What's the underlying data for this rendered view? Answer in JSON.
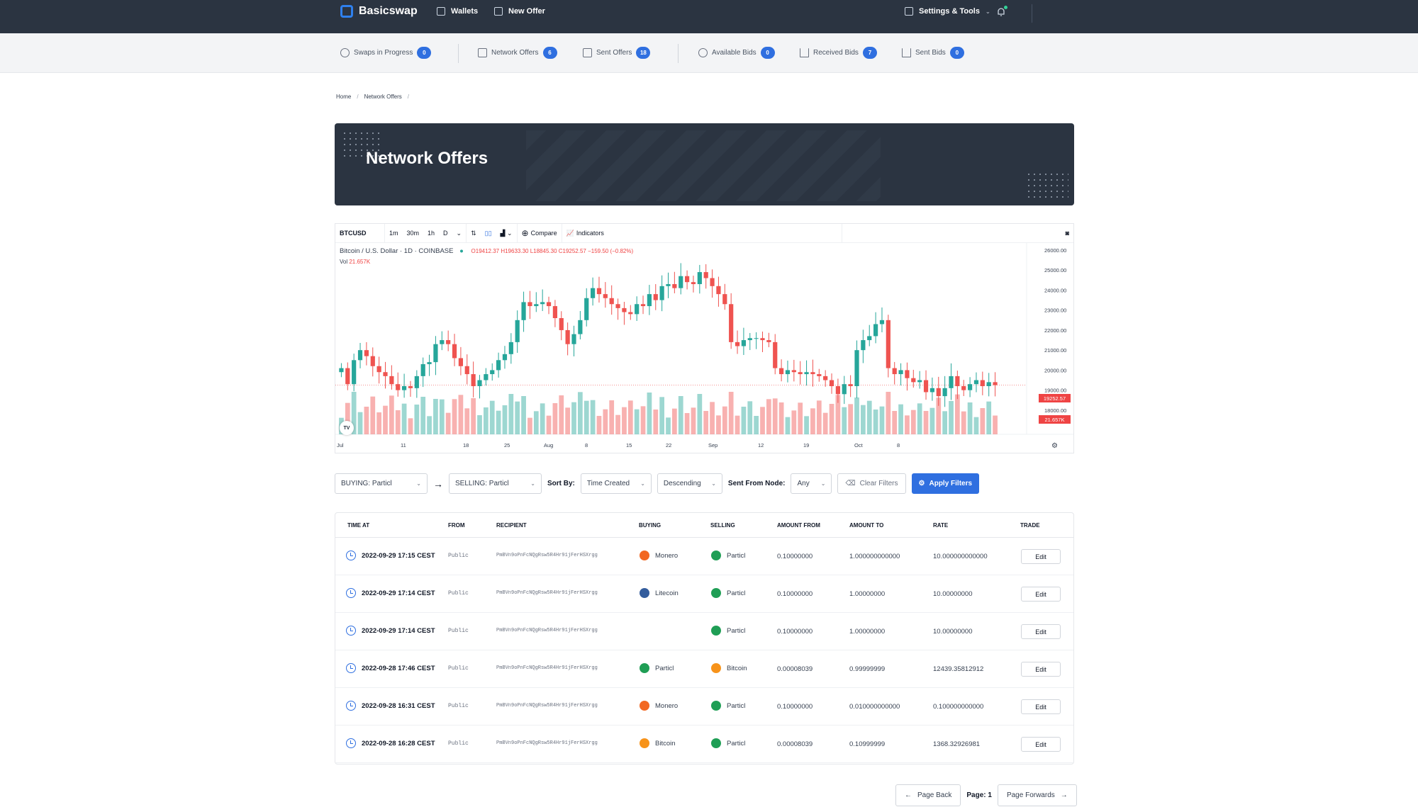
{
  "topbar": {
    "brand": "Basicswap",
    "nav": [
      {
        "label": "Wallets",
        "icon": "wallet-icon"
      },
      {
        "label": "New Offer",
        "icon": "swap-icon"
      }
    ],
    "settings_label": "Settings & Tools"
  },
  "subnav": [
    {
      "label": "Swaps in Progress",
      "count": "0",
      "icon": "swap-progress-icon"
    },
    {
      "label": "Network Offers",
      "count": "6",
      "icon": "offers-icon"
    },
    {
      "label": "Sent Offers",
      "count": "18",
      "icon": "sent-offers-icon"
    },
    {
      "label": "Available Bids",
      "count": "0",
      "icon": "clock-icon"
    },
    {
      "label": "Received Bids",
      "count": "7",
      "icon": "download-icon"
    },
    {
      "label": "Sent Bids",
      "count": "0",
      "icon": "upload-icon"
    }
  ],
  "breadcrumb": [
    "Home",
    "Network Offers"
  ],
  "page_title": "Network Offers",
  "chart": {
    "symbol": "BTCUSD",
    "intervals": [
      "1m",
      "30m",
      "1h",
      "D"
    ],
    "compare": "Compare",
    "indicators": "Indicators",
    "legend_title": "Bitcoin / U.S. Dollar · 1D · COINBASE",
    "ohlc": "O19412.37 H19633.30 L18845.30 C19252.57 −159.50 (−0.82%)",
    "vol_label": "Vol",
    "vol_value": "21.657K",
    "last_price": "19252.57",
    "last_vol": "21.657K",
    "price_ticks": [
      "26000.00",
      "25000.00",
      "24000.00",
      "23000.00",
      "22000.00",
      "21000.00",
      "20000.00",
      "19000.00",
      "18000.00"
    ],
    "date_ticks": [
      "Jul",
      "11",
      "18",
      "25",
      "Aug",
      "8",
      "15",
      "22",
      "Sep",
      "12",
      "19",
      "Oct",
      "8"
    ],
    "colors": {
      "up": "#26a69a",
      "down": "#ef5350"
    }
  },
  "chart_data": {
    "type": "candlestick",
    "title": "Bitcoin / U.S. Dollar · 1D · COINBASE",
    "ylim": [
      17500,
      26000
    ],
    "closes": [
      20100,
      19300,
      20500,
      21000,
      20700,
      20200,
      19900,
      19700,
      19300,
      19000,
      19200,
      19100,
      19700,
      20300,
      20400,
      21300,
      21500,
      21300,
      20600,
      20200,
      19800,
      19200,
      19500,
      19800,
      20000,
      20500,
      20800,
      21400,
      22500,
      23400,
      23200,
      23300,
      23400,
      23200,
      22600,
      22000,
      21300,
      21800,
      22500,
      23600,
      24100,
      23800,
      23600,
      23300,
      23100,
      22900,
      22800,
      23300,
      23200,
      23800,
      23500,
      24200,
      24300,
      24100,
      24700,
      24400,
      24300,
      24900,
      24600,
      24200,
      23800,
      23300,
      21400,
      21200,
      21500,
      21600,
      21600,
      21500,
      21400,
      20100,
      19800,
      20000,
      19900,
      19800,
      19900,
      19800,
      19700,
      19500,
      19200,
      18800,
      19300,
      19200,
      21000,
      21500,
      21700,
      22300,
      22500,
      20100,
      19800,
      20000,
      19600,
      19400,
      19500,
      18900,
      19100,
      18700,
      19100,
      19700,
      19200,
      19000,
      19300,
      19500,
      19200,
      19400,
      19250
    ],
    "volume_label": "21.657K"
  },
  "filters": {
    "buying": "BUYING: Particl",
    "selling": "SELLING: Particl",
    "sort_by_label": "Sort By:",
    "sort_field": "Time Created",
    "sort_dir": "Descending",
    "node_label": "Sent From Node:",
    "node_value": "Any",
    "clear": "Clear Filters",
    "apply": "Apply Filters"
  },
  "table": {
    "headers": [
      "TIME AT",
      "FROM",
      "RECIPIENT",
      "BUYING",
      "SELLING",
      "AMOUNT FROM",
      "AMOUNT TO",
      "RATE",
      "TRADE"
    ],
    "rows": [
      {
        "time": "2022-09-29 17:15 CEST",
        "from": "Public",
        "recipient": "PmBVn9oPnFcNQgRsw5R4Hr91jFerHSXrgg",
        "buying": "Monero",
        "selling": "Particl",
        "amount_from": "0.10000000",
        "amount_to": "1.000000000000",
        "rate": "10.000000000000",
        "trade": "Edit"
      },
      {
        "time": "2022-09-29 17:14 CEST",
        "from": "Public",
        "recipient": "PmBVn9oPnFcNQgRsw5R4Hr91jFerHSXrgg",
        "buying": "Litecoin",
        "selling": "Particl",
        "amount_from": "0.10000000",
        "amount_to": "1.00000000",
        "rate": "10.00000000",
        "trade": "Edit"
      },
      {
        "time": "2022-09-29 17:14 CEST",
        "from": "Public",
        "recipient": "PmBVn9oPnFcNQgRsw5R4Hr91jFerHSXrgg",
        "buying": "",
        "selling": "Particl",
        "amount_from": "0.10000000",
        "amount_to": "1.00000000",
        "rate": "10.00000000",
        "trade": "Edit"
      },
      {
        "time": "2022-09-28 17:46 CEST",
        "from": "Public",
        "recipient": "PmBVn9oPnFcNQgRsw5R4Hr91jFerHSXrgg",
        "buying": "Particl",
        "selling": "Bitcoin",
        "amount_from": "0.00008039",
        "amount_to": "0.99999999",
        "rate": "12439.35812912",
        "trade": "Edit"
      },
      {
        "time": "2022-09-28 16:31 CEST",
        "from": "Public",
        "recipient": "PmBVn9oPnFcNQgRsw5R4Hr91jFerHSXrgg",
        "buying": "Monero",
        "selling": "Particl",
        "amount_from": "0.10000000",
        "amount_to": "0.010000000000",
        "rate": "0.100000000000",
        "trade": "Edit"
      },
      {
        "time": "2022-09-28 16:28 CEST",
        "from": "Public",
        "recipient": "PmBVn9oPnFcNQgRsw5R4Hr91jFerHSXrgg",
        "buying": "Bitcoin",
        "selling": "Particl",
        "amount_from": "0.00008039",
        "amount_to": "0.10999999",
        "rate": "1368.32926981",
        "trade": "Edit"
      }
    ],
    "coin_colors": {
      "Monero": "#f26822",
      "Litecoin": "#345d9d",
      "Particl": "#1f9e55",
      "Bitcoin": "#f7931a"
    }
  },
  "pager": {
    "back": "Page Back",
    "page": "Page: 1",
    "forward": "Page Forwards"
  }
}
